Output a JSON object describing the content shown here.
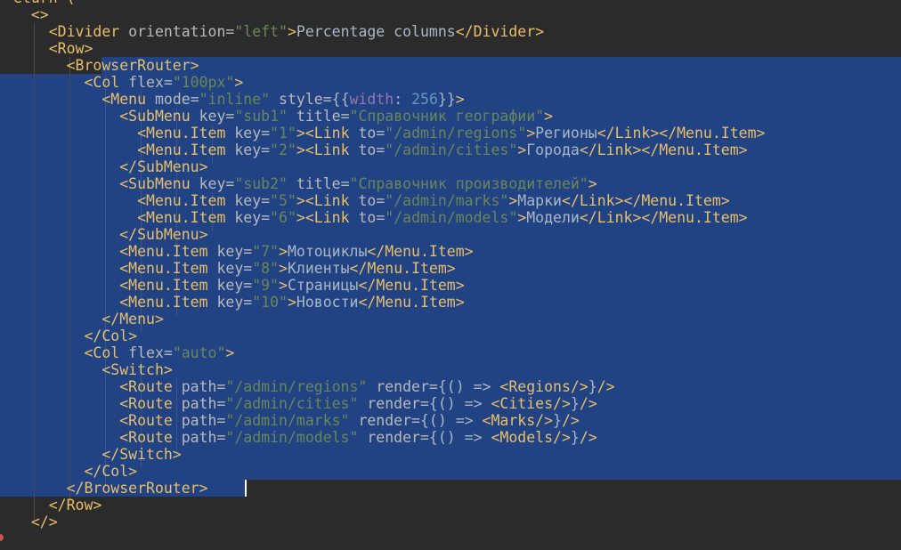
{
  "editor": {
    "lines": [
      [
        {
          "c": "t",
          "v": "eturn ("
        }
      ],
      [
        {
          "c": "t",
          "v": "  <>"
        }
      ],
      [
        {
          "c": "t",
          "v": "    <Divider "
        },
        {
          "c": "a",
          "v": "orientation="
        },
        {
          "c": "s",
          "v": "\"left\""
        },
        {
          "c": "t",
          "v": ">"
        },
        {
          "c": "x",
          "v": "Percentage columns"
        },
        {
          "c": "t",
          "v": "</Divider>"
        }
      ],
      [
        {
          "c": "t",
          "v": "    <Row>"
        }
      ],
      [
        {
          "c": "t",
          "v": "      <BrowserRouter>"
        }
      ],
      [
        {
          "c": "t",
          "v": "        <Col "
        },
        {
          "c": "a",
          "v": "flex="
        },
        {
          "c": "s",
          "v": "\"100px\""
        },
        {
          "c": "t",
          "v": ">"
        }
      ],
      [
        {
          "c": "t",
          "v": "          <Menu "
        },
        {
          "c": "a",
          "v": "mode="
        },
        {
          "c": "s",
          "v": "\"inline\""
        },
        {
          "c": "x",
          "v": " "
        },
        {
          "c": "a",
          "v": "style="
        },
        {
          "c": "x",
          "v": "{{"
        },
        {
          "c": "k",
          "v": "width"
        },
        {
          "c": "x",
          "v": ": "
        },
        {
          "c": "n",
          "v": "256"
        },
        {
          "c": "x",
          "v": "}}"
        },
        {
          "c": "t",
          "v": ">"
        }
      ],
      [
        {
          "c": "t",
          "v": "            <SubMenu "
        },
        {
          "c": "a",
          "v": "key="
        },
        {
          "c": "s",
          "v": "\"sub1\""
        },
        {
          "c": "x",
          "v": " "
        },
        {
          "c": "a",
          "v": "title="
        },
        {
          "c": "s",
          "v": "\"Справочник географии\""
        },
        {
          "c": "t",
          "v": ">"
        }
      ],
      [
        {
          "c": "t",
          "v": "              <Menu.Item "
        },
        {
          "c": "a",
          "v": "key="
        },
        {
          "c": "s",
          "v": "\"1\""
        },
        {
          "c": "t",
          "v": "><Link "
        },
        {
          "c": "a",
          "v": "to="
        },
        {
          "c": "s",
          "v": "\"/admin/regions\""
        },
        {
          "c": "t",
          "v": ">"
        },
        {
          "c": "x",
          "v": "Регионы"
        },
        {
          "c": "t",
          "v": "</Link></Menu.Item>"
        }
      ],
      [
        {
          "c": "t",
          "v": "              <Menu.Item "
        },
        {
          "c": "a",
          "v": "key="
        },
        {
          "c": "s",
          "v": "\"2\""
        },
        {
          "c": "t",
          "v": "><Link "
        },
        {
          "c": "a",
          "v": "to="
        },
        {
          "c": "s",
          "v": "\"/admin/cities\""
        },
        {
          "c": "t",
          "v": ">"
        },
        {
          "c": "x",
          "v": "Города"
        },
        {
          "c": "t",
          "v": "</Link></Menu.Item>"
        }
      ],
      [
        {
          "c": "t",
          "v": "            </SubMenu>"
        }
      ],
      [
        {
          "c": "t",
          "v": "            <SubMenu "
        },
        {
          "c": "a",
          "v": "key="
        },
        {
          "c": "s",
          "v": "\"sub2\""
        },
        {
          "c": "x",
          "v": " "
        },
        {
          "c": "a",
          "v": "title="
        },
        {
          "c": "s",
          "v": "\"Справочник производителей\""
        },
        {
          "c": "t",
          "v": ">"
        }
      ],
      [
        {
          "c": "t",
          "v": "              <Menu.Item "
        },
        {
          "c": "a",
          "v": "key="
        },
        {
          "c": "s",
          "v": "\"5\""
        },
        {
          "c": "t",
          "v": "><Link "
        },
        {
          "c": "a",
          "v": "to="
        },
        {
          "c": "s",
          "v": "\"/admin/marks\""
        },
        {
          "c": "t",
          "v": ">"
        },
        {
          "c": "x",
          "v": "Марки"
        },
        {
          "c": "t",
          "v": "</Link></Menu.Item>"
        }
      ],
      [
        {
          "c": "t",
          "v": "              <Menu.Item "
        },
        {
          "c": "a",
          "v": "key="
        },
        {
          "c": "s",
          "v": "\"6\""
        },
        {
          "c": "t",
          "v": "><Link "
        },
        {
          "c": "a",
          "v": "to="
        },
        {
          "c": "s",
          "v": "\"/admin/models\""
        },
        {
          "c": "t",
          "v": ">"
        },
        {
          "c": "x",
          "v": "Модели"
        },
        {
          "c": "t",
          "v": "</Link></Menu.Item>"
        }
      ],
      [
        {
          "c": "t",
          "v": "            </SubMenu>"
        }
      ],
      [
        {
          "c": "t",
          "v": "            <Menu.Item "
        },
        {
          "c": "a",
          "v": "key="
        },
        {
          "c": "s",
          "v": "\"7\""
        },
        {
          "c": "t",
          "v": ">"
        },
        {
          "c": "x",
          "v": "Мотоциклы"
        },
        {
          "c": "t",
          "v": "</Menu.Item>"
        }
      ],
      [
        {
          "c": "t",
          "v": "            <Menu.Item "
        },
        {
          "c": "a",
          "v": "key="
        },
        {
          "c": "s",
          "v": "\"8\""
        },
        {
          "c": "t",
          "v": ">"
        },
        {
          "c": "x",
          "v": "Клиенты"
        },
        {
          "c": "t",
          "v": "</Menu.Item>"
        }
      ],
      [
        {
          "c": "t",
          "v": "            <Menu.Item "
        },
        {
          "c": "a",
          "v": "key="
        },
        {
          "c": "s",
          "v": "\"9\""
        },
        {
          "c": "t",
          "v": ">"
        },
        {
          "c": "x",
          "v": "Страницы"
        },
        {
          "c": "t",
          "v": "</Menu.Item>"
        }
      ],
      [
        {
          "c": "t",
          "v": "            <Menu.Item "
        },
        {
          "c": "a",
          "v": "key="
        },
        {
          "c": "s",
          "v": "\"10\""
        },
        {
          "c": "t",
          "v": ">"
        },
        {
          "c": "x",
          "v": "Новости"
        },
        {
          "c": "t",
          "v": "</Menu.Item>"
        }
      ],
      [
        {
          "c": "t",
          "v": "          </Menu>"
        }
      ],
      [
        {
          "c": "t",
          "v": "        </Col>"
        }
      ],
      [
        {
          "c": "t",
          "v": "        <Col "
        },
        {
          "c": "a",
          "v": "flex="
        },
        {
          "c": "s",
          "v": "\"auto\""
        },
        {
          "c": "t",
          "v": ">"
        }
      ],
      [
        {
          "c": "t",
          "v": "          <Switch>"
        }
      ],
      [
        {
          "c": "t",
          "v": "            <Route "
        },
        {
          "c": "a",
          "v": "path="
        },
        {
          "c": "s",
          "v": "\"/admin/regions\""
        },
        {
          "c": "x",
          "v": " "
        },
        {
          "c": "a",
          "v": "render="
        },
        {
          "c": "x",
          "v": "{() => "
        },
        {
          "c": "t",
          "v": "<Regions/>"
        },
        {
          "c": "x",
          "v": "}"
        },
        {
          "c": "t",
          "v": "/>"
        }
      ],
      [
        {
          "c": "t",
          "v": "            <Route "
        },
        {
          "c": "a",
          "v": "path="
        },
        {
          "c": "s",
          "v": "\"/admin/cities\""
        },
        {
          "c": "x",
          "v": " "
        },
        {
          "c": "a",
          "v": "render="
        },
        {
          "c": "x",
          "v": "{() => "
        },
        {
          "c": "t",
          "v": "<Cities/>"
        },
        {
          "c": "x",
          "v": "}"
        },
        {
          "c": "t",
          "v": "/>"
        }
      ],
      [
        {
          "c": "t",
          "v": "            <Route "
        },
        {
          "c": "a",
          "v": "path="
        },
        {
          "c": "s",
          "v": "\"/admin/marks\""
        },
        {
          "c": "x",
          "v": " "
        },
        {
          "c": "a",
          "v": "render="
        },
        {
          "c": "x",
          "v": "{() => "
        },
        {
          "c": "t",
          "v": "<Marks/>"
        },
        {
          "c": "x",
          "v": "}"
        },
        {
          "c": "t",
          "v": "/>"
        }
      ],
      [
        {
          "c": "t",
          "v": "            <Route "
        },
        {
          "c": "a",
          "v": "path="
        },
        {
          "c": "s",
          "v": "\"/admin/models\""
        },
        {
          "c": "x",
          "v": " "
        },
        {
          "c": "a",
          "v": "render="
        },
        {
          "c": "x",
          "v": "{() => "
        },
        {
          "c": "t",
          "v": "<Models/>"
        },
        {
          "c": "x",
          "v": "}"
        },
        {
          "c": "t",
          "v": "/>"
        }
      ],
      [
        {
          "c": "t",
          "v": "          </Switch>"
        }
      ],
      [
        {
          "c": "t",
          "v": "        </Col>"
        }
      ],
      [
        {
          "c": "t",
          "v": "      </BrowserRouter>"
        }
      ],
      [
        {
          "c": "t",
          "v": "    </Row>"
        }
      ],
      [
        {
          "c": "t",
          "v": "  </>"
        }
      ]
    ],
    "colors": {
      "background": "#2b2b2b",
      "selection": "#214283",
      "tag": "#e8bf6a",
      "attribute": "#bababa",
      "string": "#6a8759",
      "text": "#a9b7c6",
      "property": "#9876aa",
      "number": "#6897bb"
    }
  }
}
